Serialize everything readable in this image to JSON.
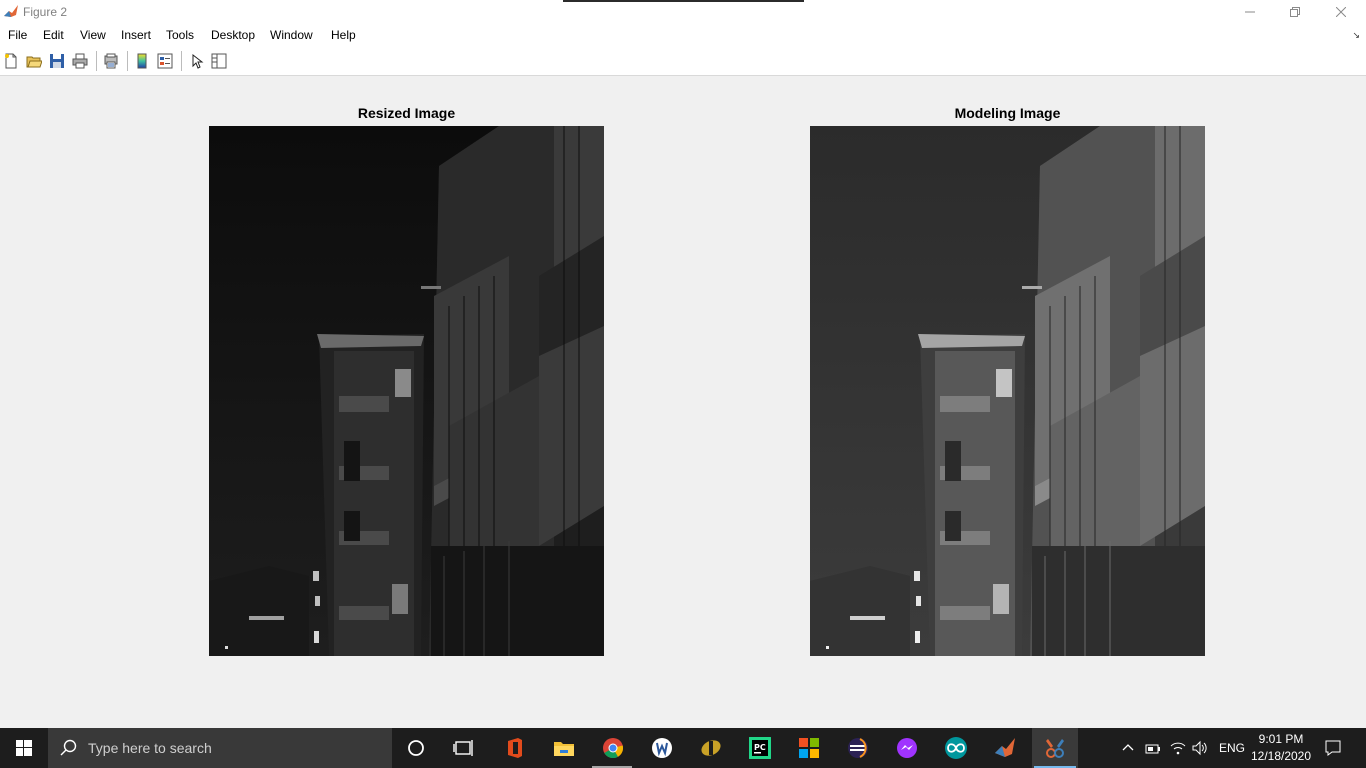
{
  "window": {
    "title": "Figure 2"
  },
  "menu": [
    "File",
    "Edit",
    "View",
    "Insert",
    "Tools",
    "Desktop",
    "Window",
    "Help"
  ],
  "toolbar": {
    "icons": [
      "new-figure-icon",
      "open-file-icon",
      "save-icon",
      "print-icon",
      "print-preview-icon",
      "colorbar-icon",
      "legend-icon",
      "edit-plot-arrow-icon",
      "property-inspector-icon"
    ]
  },
  "figure": {
    "left_title": "Resized Image",
    "right_title": "Modeling Image"
  },
  "taskbar": {
    "search_placeholder": "Type here to search",
    "apps": [
      "cortana-icon",
      "task-view-icon",
      "office-icon",
      "file-explorer-icon",
      "chrome-icon",
      "word-icon",
      "imageJ-icon",
      "pycharm-icon",
      "microsoft-store-icon",
      "eclipse-icon",
      "messenger-icon",
      "arduino-icon",
      "matlab-icon",
      "tool-icon"
    ],
    "language": "ENG",
    "time": "9:01 PM",
    "date": "12/18/2020"
  },
  "colors": {
    "accent": "#0078d7",
    "matlab_orange": "#e16737",
    "taskbar_bg": "#1d1d1d"
  }
}
